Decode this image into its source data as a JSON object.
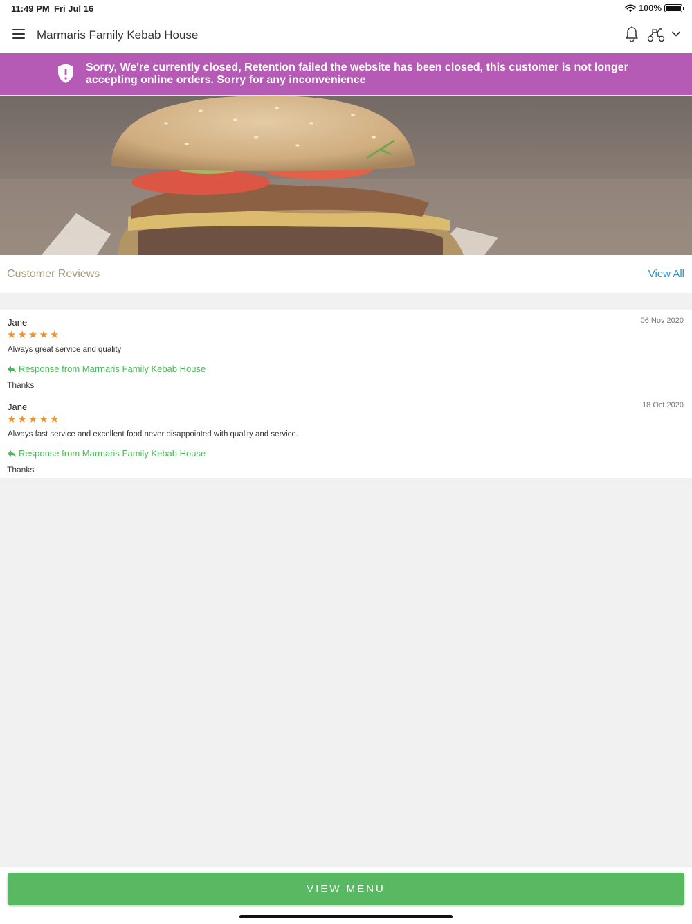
{
  "status_bar": {
    "time": "11:49 PM",
    "date": "Fri Jul 16",
    "battery": "100%",
    "icons": [
      "wifi-icon",
      "battery-icon"
    ]
  },
  "nav": {
    "title": "Marmaris Family Kebab House",
    "icons": [
      "menu-icon",
      "bell-icon",
      "scooter-icon",
      "chevron-down-icon"
    ]
  },
  "banner": {
    "message": "Sorry, We're currently closed, Retention failed the website has been closed, this customer is not longer accepting online orders. Sorry for any inconvenience",
    "icon": "shield-alert-icon",
    "color": "#b55ab5"
  },
  "reviews": {
    "title": "Customer Reviews",
    "view_all_label": "View All",
    "items": [
      {
        "name": "Jane",
        "date": "06 Nov 2020",
        "rating": 5,
        "text": "Always great service and quality",
        "response_label": "Response from Marmaris Family Kebab House",
        "response": "Thanks"
      },
      {
        "name": "Jane",
        "date": "18 Oct 2020",
        "rating": 5,
        "text": "Always fast service and excellent food never disappointed with quality and service.",
        "response_label": "Response from Marmaris Family Kebab House",
        "response": "Thanks"
      }
    ]
  },
  "footer": {
    "view_menu_label": "VIEW MENU",
    "button_color": "#59b862"
  },
  "colors": {
    "star": "#f2932a",
    "response": "#4db85a",
    "link": "#2a93c8"
  }
}
